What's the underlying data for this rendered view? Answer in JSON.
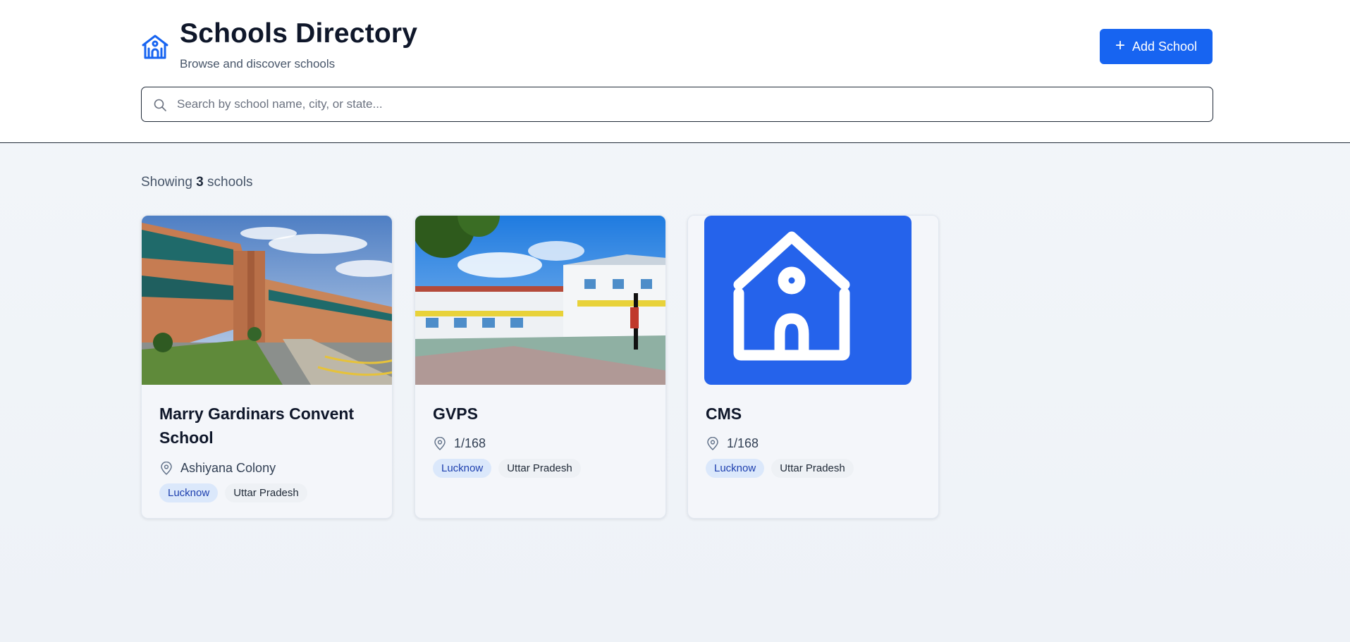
{
  "header": {
    "title": "Schools Directory",
    "subtitle": "Browse and discover schools",
    "add_button_label": "Add School",
    "accent_color": "#1764f1"
  },
  "search": {
    "placeholder": "Search by school name, city, or state...",
    "value": ""
  },
  "results": {
    "prefix": "Showing",
    "count": "3",
    "suffix": "schools"
  },
  "schools": [
    {
      "name": "Marry Gardinars Convent School",
      "address": "Ashiyana Colony",
      "city": "Lucknow",
      "state": "Uttar Pradesh",
      "image": "campus-building-photo"
    },
    {
      "name": "GVPS",
      "address": "1/168",
      "city": "Lucknow",
      "state": "Uttar Pradesh",
      "image": "courtyard-basketball-photo"
    },
    {
      "name": "CMS",
      "address": "1/168",
      "city": "Lucknow",
      "state": "Uttar Pradesh",
      "image": "school-icon-placeholder"
    }
  ]
}
